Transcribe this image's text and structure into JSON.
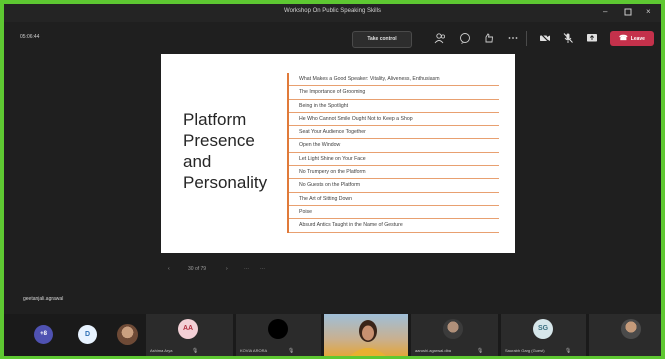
{
  "window": {
    "title": "Workshop On Public Speaking Skills"
  },
  "toolbar": {
    "timer": "05:06:44",
    "take_control": "Take control",
    "leave": "Leave"
  },
  "slide": {
    "title_lines": [
      "Platform",
      "Presence",
      "and",
      "Personality"
    ],
    "items": [
      "What Makes a Good Speaker: Vitality, Aliveness, Enthusiasm",
      "The Importance of Grooming",
      "Being in the Spotlight",
      "He Who Cannot Smile Ought Not to Keep a Shop",
      "Seat Your Audience Together",
      "Open the Window",
      "Let Light Shine on Your Face",
      "No Trumpery on the Platform",
      "No Guests on the Platform",
      "The Art of Sitting Down",
      "Poise",
      "Absurd Antics Taught in the Name of Gesture"
    ],
    "page_indicator": "30 of 79"
  },
  "presenter": "geetanjali.agrawal",
  "participants": {
    "overflow_count": "+8",
    "tiles": [
      {
        "initials": "AA",
        "name": "Ashima Arya"
      },
      {
        "initials": "",
        "name": "KOVIA ARORA"
      },
      {
        "initials": "",
        "name": ""
      },
      {
        "initials": "",
        "name": "aarushi.agarwal.dba"
      },
      {
        "initials": "SG",
        "name": "Saurabh Garg (Guest)"
      },
      {
        "initials": "",
        "name": ""
      }
    ]
  },
  "colors": {
    "frame": "#5ec832",
    "leave_button": "#c4314b",
    "slide_accent": "#e07a3a"
  }
}
